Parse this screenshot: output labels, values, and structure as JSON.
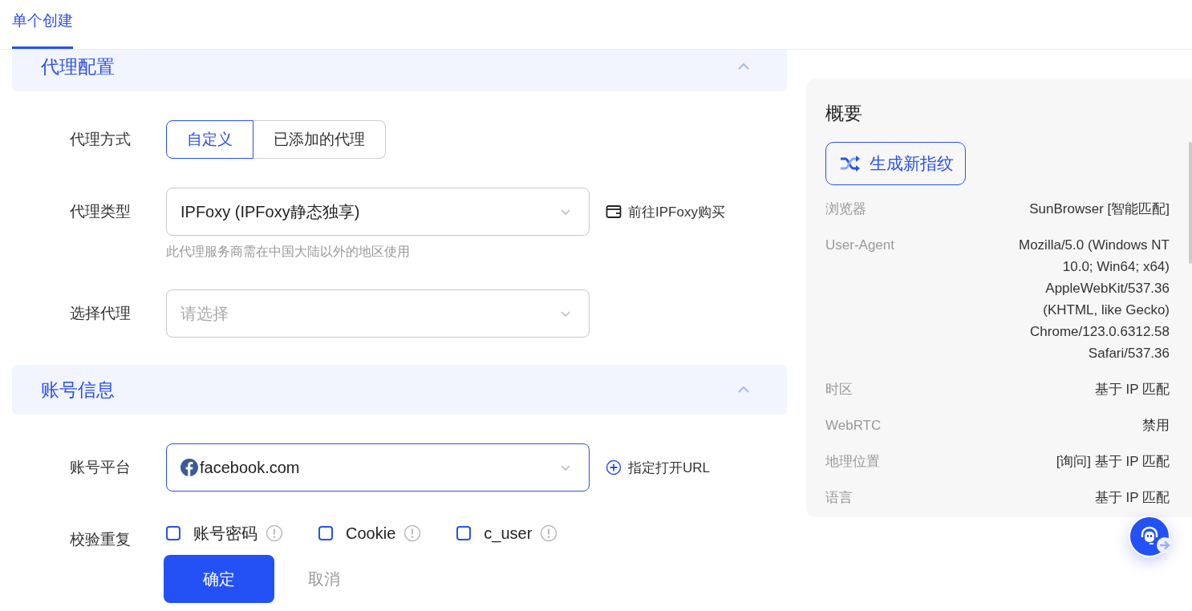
{
  "tabs": [
    {
      "label": "单个创建",
      "selected": true
    }
  ],
  "sections": [
    {
      "title": "代理配置",
      "expanded": true,
      "fields": [
        {
          "kind": "segmented",
          "label": "代理方式",
          "options": [
            {
              "label": "自定义",
              "selected": true
            },
            {
              "label": "已添加的代理",
              "selected": false
            }
          ]
        },
        {
          "kind": "select",
          "label": "代理类型",
          "value": "IPFoxy (IPFoxy静态独享)",
          "hint": "此代理服务商需在中国大陆以外的地区使用",
          "link": {
            "kind": "external",
            "label": "前往IPFoxy购买"
          }
        },
        {
          "kind": "select",
          "label": "选择代理",
          "placeholder": "请选择"
        }
      ]
    },
    {
      "title": "账号信息",
      "expanded": true,
      "fields": [
        {
          "kind": "select",
          "label": "账号平台",
          "value": "facebook.com",
          "focused": true,
          "platform_icon": true,
          "link": {
            "kind": "add",
            "label": "指定打开URL"
          }
        },
        {
          "kind": "checks",
          "label": "校验重复",
          "options": [
            {
              "label": "账号密码",
              "checked": false
            },
            {
              "label": "Cookie",
              "checked": false
            },
            {
              "label": "c_user",
              "checked": false
            }
          ]
        }
      ]
    }
  ],
  "summary": {
    "title": "概要",
    "action": "生成新指纹",
    "rows": [
      {
        "label": "浏览器",
        "value": "SunBrowser [智能匹配]"
      },
      {
        "label": "User-Agent",
        "value": "Mozilla/5.0 (Windows NT 10.0; Win64; x64) AppleWebKit/537.36 (KHTML, like Gecko) Chrome/123.0.6312.58 Safari/537.36"
      },
      {
        "label": "时区",
        "value": "基于 IP 匹配"
      },
      {
        "label": "WebRTC",
        "value": "禁用"
      },
      {
        "label": "地理位置",
        "value": "[询问] 基于 IP 匹配"
      },
      {
        "label": "语言",
        "value": "基于 IP 匹配"
      }
    ]
  },
  "footer": {
    "confirm": "确定",
    "cancel": "取消"
  }
}
